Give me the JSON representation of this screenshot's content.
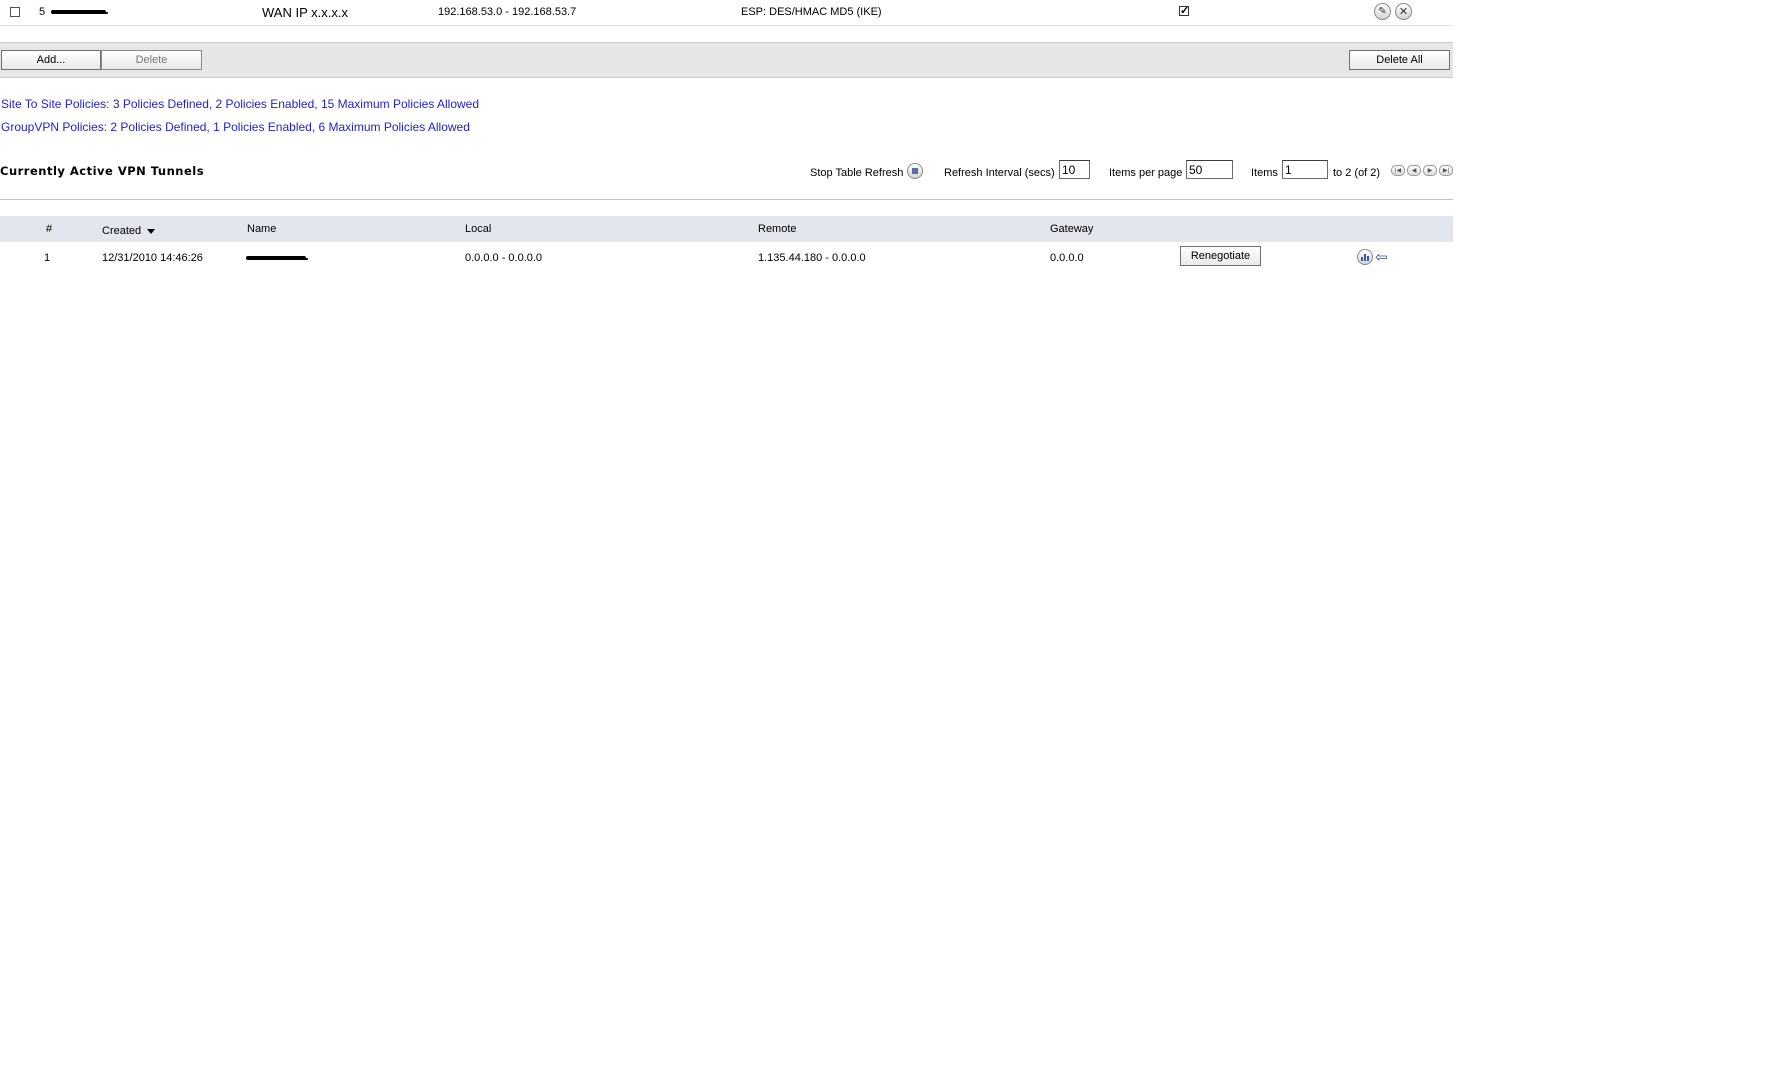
{
  "policy_row": {
    "number": "5",
    "gateway": "WAN IP x.x.x.x",
    "destinations": "192.168.53.0 - 192.168.53.7",
    "crypto_suite": "ESP: DES/HMAC MD5 (IKE)",
    "enabled": true
  },
  "toolbar": {
    "add_label": "Add...",
    "delete_label": "Delete",
    "delete_all_label": "Delete All"
  },
  "summary": {
    "site_to_site": "Site To Site Policies: 3 Policies Defined, 2 Policies Enabled, 15 Maximum Policies Allowed",
    "group_vpn": "GroupVPN Policies: 2 Policies Defined, 1 Policies Enabled, 6 Maximum Policies Allowed"
  },
  "tunnels": {
    "title": "Currently Active VPN Tunnels",
    "controls": {
      "stop_refresh_label": "Stop Table Refresh",
      "refresh_interval_label": "Refresh Interval (secs)",
      "refresh_interval_value": "10",
      "items_per_page_label": "Items per page",
      "items_per_page_value": "50",
      "items_label": "Items",
      "items_value": "1",
      "items_range": "to 2 (of 2)"
    },
    "columns": {
      "num": "#",
      "created": "Created",
      "name": "Name",
      "local": "Local",
      "remote": "Remote",
      "gateway": "Gateway"
    },
    "rows": [
      {
        "num": "1",
        "created": "12/31/2010 14:46:26",
        "local": "0.0.0.0 - 0.0.0.0",
        "remote": "1.135.44.180 - 0.0.0.0",
        "gateway": "0.0.0.0",
        "renegotiate_label": "Renegotiate"
      }
    ]
  },
  "icons": [
    "edit-icon",
    "delete-icon",
    "stop-refresh-icon",
    "first-page-icon",
    "prev-page-icon",
    "next-page-icon",
    "last-page-icon",
    "statistics-icon",
    "tunnel-arrow-icon"
  ],
  "colors": {
    "link_blue": "#1f1fd0",
    "toolbar_bg": "#e6e6e6",
    "header_band": "#e3e6ee"
  }
}
